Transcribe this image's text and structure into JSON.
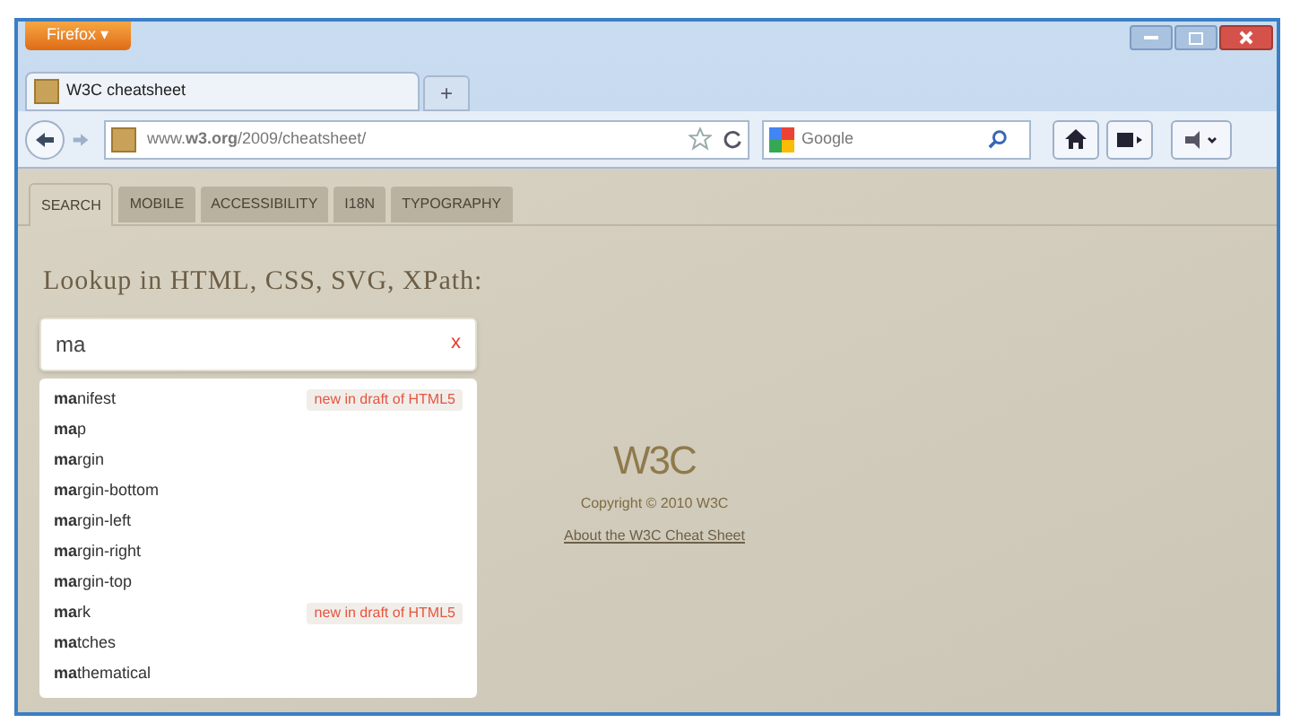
{
  "browser": {
    "menu_button": "Firefox ▾",
    "tabs": [
      {
        "title": "W3C cheatsheet",
        "selected": true
      }
    ],
    "new_tab": "+",
    "address": "www.**w3.org**/2009/cheatsheet/",
    "search_placeholder": "Google"
  },
  "page_tabs": [
    {
      "label": "SEARCH",
      "selected": true
    },
    {
      "label": "MOBILE",
      "selected": false
    },
    {
      "label": "ACCESSIBILITY",
      "selected": false
    },
    {
      "label": "I18N",
      "selected": false
    },
    {
      "label": "TYPOGRAPHY",
      "selected": false
    }
  ],
  "heading": "Lookup in HTML, CSS, SVG, XPath:",
  "search": {
    "value": "ma",
    "clear": "x"
  },
  "suggestions": [
    {
      "text": "**ma**nifest",
      "badge": "new in draft of HTML5"
    },
    {
      "text": "**ma**p"
    },
    {
      "text": "**ma**rgin"
    },
    {
      "text": "**ma**rgin-bottom"
    },
    {
      "text": "**ma**rgin-left"
    },
    {
      "text": "**ma**rgin-right"
    },
    {
      "text": "**ma**rgin-top"
    },
    {
      "text": "**ma**rk",
      "badge": "new in draft of HTML5"
    },
    {
      "text": "**ma**tches"
    },
    {
      "text": "**ma**thematical"
    }
  ],
  "footer": {
    "logo": "W3C",
    "copyright": "Copyright © 2010 W3C",
    "link": "About the W3C Cheat Sheet"
  }
}
